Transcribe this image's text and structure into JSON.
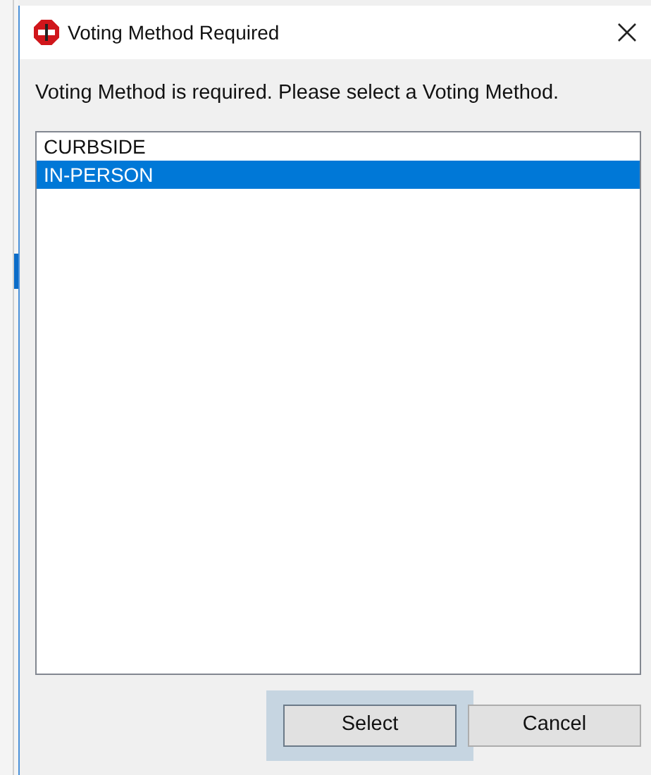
{
  "window": {
    "title": "Voting Method Required"
  },
  "message": "Voting Method is required. Please select a Voting Method.",
  "options": [
    {
      "label": "CURBSIDE",
      "selected": false
    },
    {
      "label": "IN-PERSON",
      "selected": true
    }
  ],
  "buttons": [
    {
      "label": "Select",
      "highlighted": true
    },
    {
      "label": "Cancel",
      "highlighted": false
    }
  ]
}
